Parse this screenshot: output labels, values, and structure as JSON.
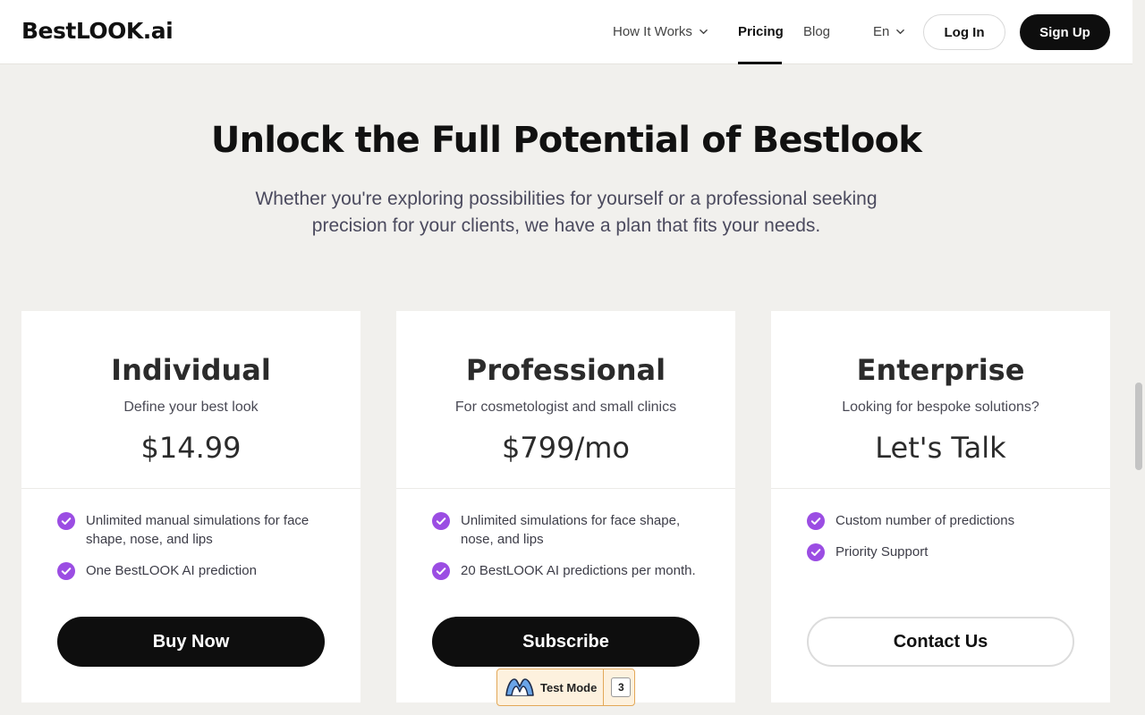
{
  "header": {
    "logo": "BestLOOK.ai",
    "nav": [
      {
        "label": "How It Works",
        "has_dropdown": true
      },
      {
        "label": "Pricing",
        "active": true
      },
      {
        "label": "Blog"
      }
    ],
    "language": "En",
    "login_label": "Log In",
    "signup_label": "Sign Up"
  },
  "hero": {
    "title": "Unlock the Full Potential of Bestlook",
    "subtitle": "Whether you're exploring possibilities for yourself or a professional seeking precision for your clients, we have a plan that fits your needs."
  },
  "plans": [
    {
      "name": "Individual",
      "tagline": "Define your best look",
      "price": "$14.99",
      "features": [
        "Unlimited manual simulations for face shape, nose, and lips",
        "One BestLOOK AI prediction"
      ],
      "button": "Buy Now"
    },
    {
      "name": "Professional",
      "tagline": "For cosmetologist and small clinics",
      "price": "$799/mo",
      "features": [
        "Unlimited simulations for face shape, nose, and lips",
        "20 BestLOOK AI predictions per month."
      ],
      "button": "Subscribe"
    },
    {
      "name": "Enterprise",
      "tagline": "Looking for bespoke solutions?",
      "price": "Let's Talk",
      "features": [
        "Custom number of predictions",
        "Priority Support"
      ],
      "button": "Contact Us"
    }
  ],
  "test_mode": {
    "label": "Test Mode",
    "count": "3"
  },
  "colors": {
    "accent_check": "#9b4de3",
    "button_dark": "#0e0e0e",
    "page_bg": "#f1f0ed"
  },
  "icons": {
    "feature_check": "check-circle-icon",
    "dropdown": "chevron-down-icon",
    "test_mode": "mountain-logo-icon"
  }
}
